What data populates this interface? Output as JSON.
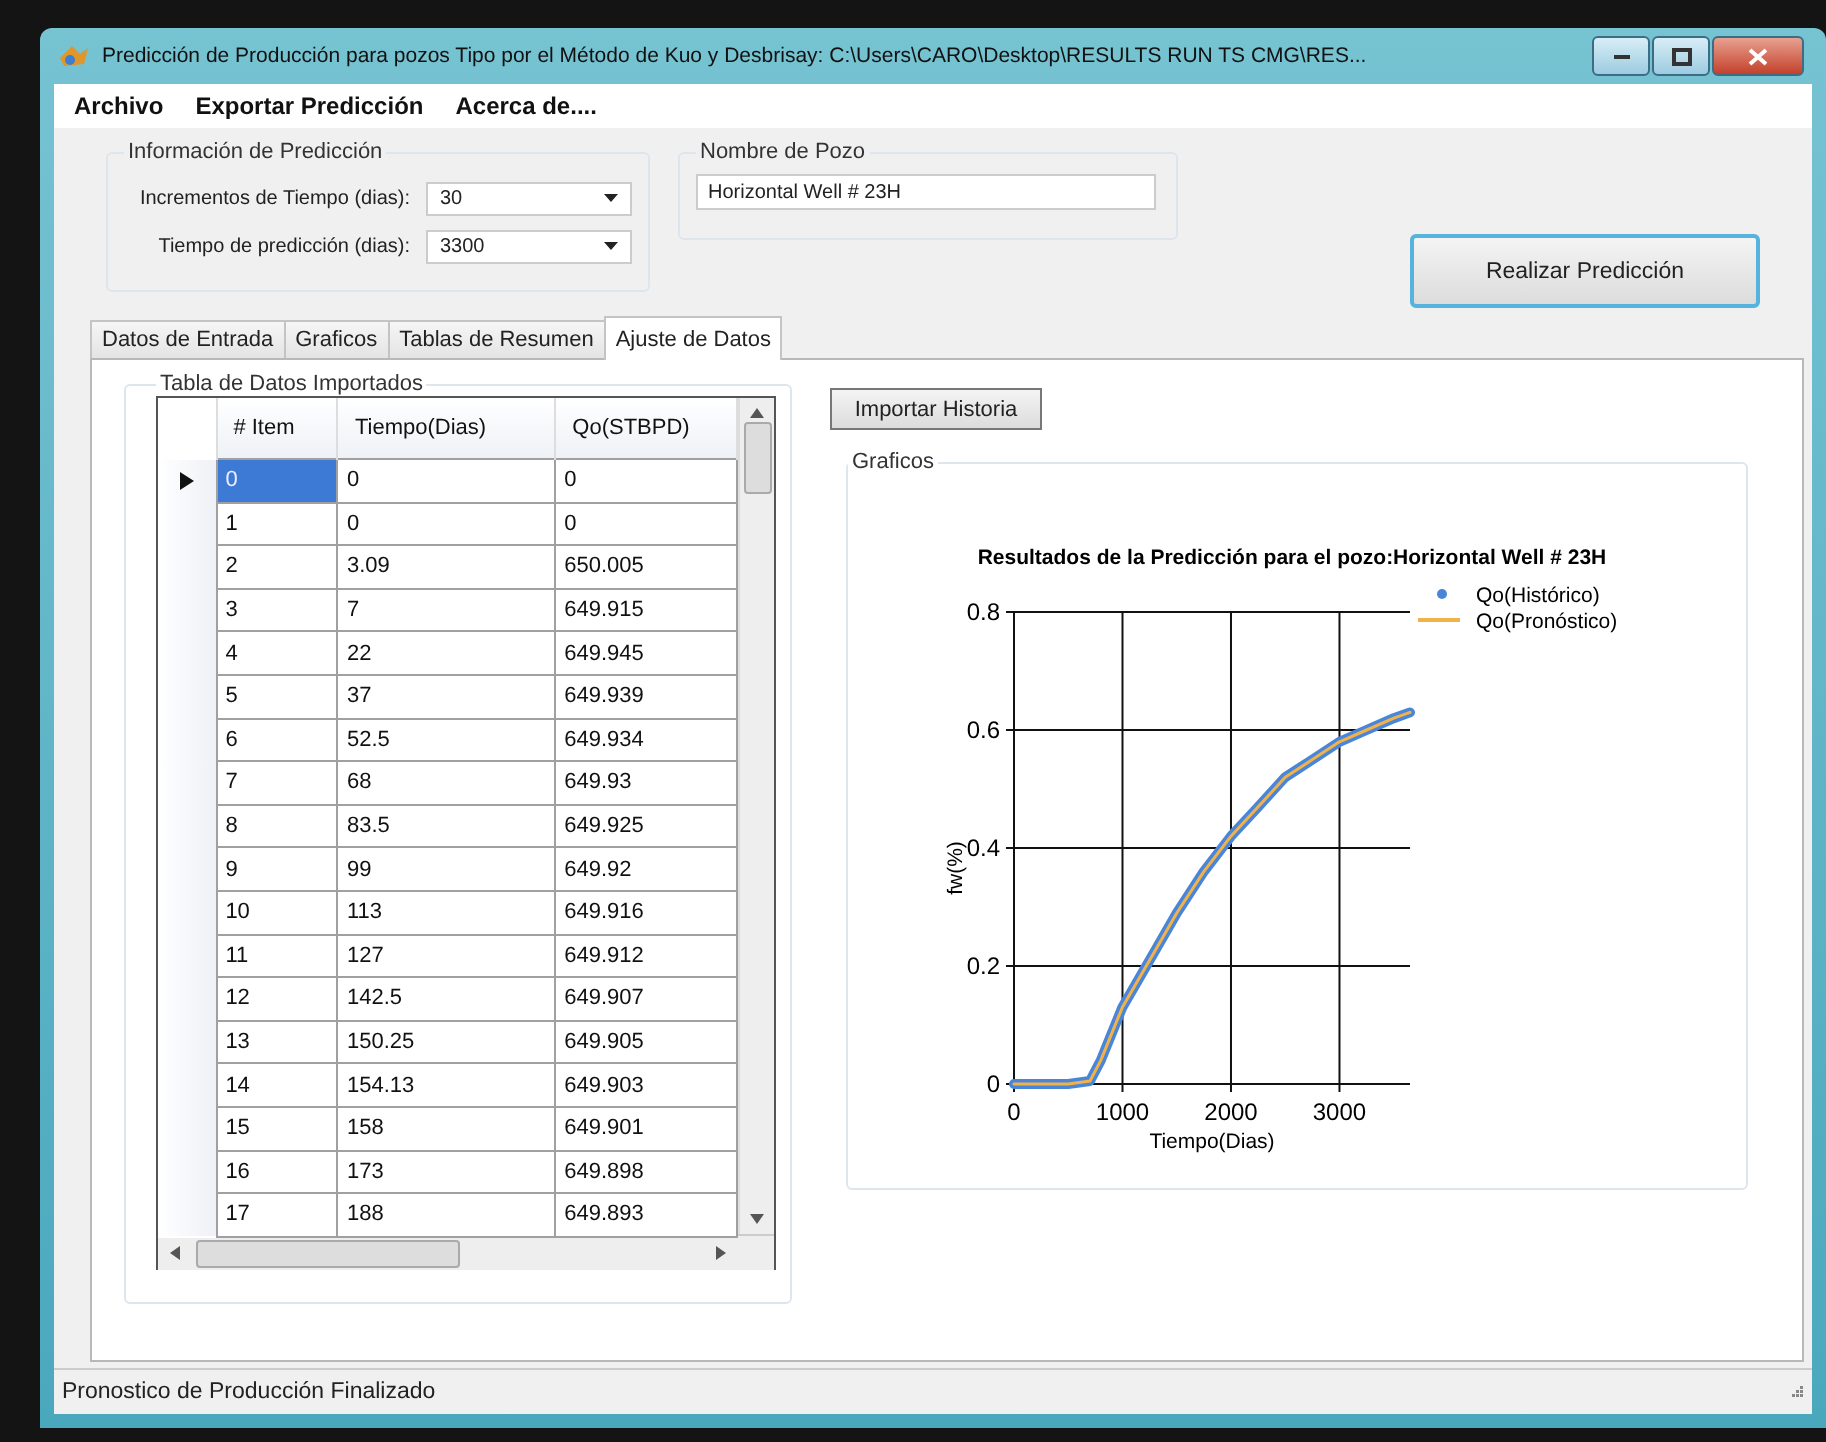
{
  "window": {
    "title": "Predicción de Producción para pozos Tipo por el Método de Kuo y Desbrisay: C:\\Users\\CARO\\Desktop\\RESULTS RUN TS CMG\\RES..."
  },
  "menu": [
    "Archivo",
    "Exportar Predicción",
    "Acerca de...."
  ],
  "prediction_info": {
    "title": "Información de Predicción",
    "fields": [
      {
        "label": "Incrementos de Tiempo (dias):",
        "value": "30"
      },
      {
        "label": "Tiempo de predicción (dias):",
        "value": "3300"
      }
    ]
  },
  "well_name": {
    "title": "Nombre de Pozo",
    "value": "Horizontal Well # 23H"
  },
  "predict_button": "Realizar Predicción",
  "tabs": [
    {
      "label": "Datos de Entrada",
      "selected": false
    },
    {
      "label": "Graficos",
      "selected": false
    },
    {
      "label": "Tablas de Resumen",
      "selected": false
    },
    {
      "label": "Ajuste de Datos",
      "selected": true
    }
  ],
  "imported_table": {
    "title": "Tabla de Datos Importados",
    "columns": [
      "# Item",
      "Tiempo(Dias)",
      "Qo(STBPD)"
    ],
    "rows": [
      {
        "cells": [
          "0",
          "0",
          "0"
        ],
        "selected": true
      },
      {
        "cells": [
          "1",
          "0",
          "0"
        ],
        "selected": false
      },
      {
        "cells": [
          "2",
          "3.09",
          "650.005"
        ],
        "selected": false
      },
      {
        "cells": [
          "3",
          "7",
          "649.915"
        ],
        "selected": false
      },
      {
        "cells": [
          "4",
          "22",
          "649.945"
        ],
        "selected": false
      },
      {
        "cells": [
          "5",
          "37",
          "649.939"
        ],
        "selected": false
      },
      {
        "cells": [
          "6",
          "52.5",
          "649.934"
        ],
        "selected": false
      },
      {
        "cells": [
          "7",
          "68",
          "649.93"
        ],
        "selected": false
      },
      {
        "cells": [
          "8",
          "83.5",
          "649.925"
        ],
        "selected": false
      },
      {
        "cells": [
          "9",
          "99",
          "649.92"
        ],
        "selected": false
      },
      {
        "cells": [
          "10",
          "113",
          "649.916"
        ],
        "selected": false
      },
      {
        "cells": [
          "11",
          "127",
          "649.912"
        ],
        "selected": false
      },
      {
        "cells": [
          "12",
          "142.5",
          "649.907"
        ],
        "selected": false
      },
      {
        "cells": [
          "13",
          "150.25",
          "649.905"
        ],
        "selected": false
      },
      {
        "cells": [
          "14",
          "154.13",
          "649.903"
        ],
        "selected": false
      },
      {
        "cells": [
          "15",
          "158",
          "649.901"
        ],
        "selected": false
      },
      {
        "cells": [
          "16",
          "173",
          "649.898"
        ],
        "selected": false
      },
      {
        "cells": [
          "17",
          "188",
          "649.893"
        ],
        "selected": false
      }
    ]
  },
  "import_button": "Importar Historia",
  "charts_group": {
    "title": "Graficos",
    "chart_data": {
      "type": "line",
      "title": "Resultados de la Predicción para el pozo:Horizontal Well # 23H",
      "xlabel": "Tiempo(Dias)",
      "ylabel": "fw(%)",
      "x": [
        0,
        250,
        500,
        700,
        800,
        1000,
        1250,
        1500,
        1750,
        2000,
        2250,
        2500,
        2750,
        3000,
        3250,
        3500,
        3650
      ],
      "series": [
        {
          "name": "Qo(Histórico)",
          "color": "#4a86d8",
          "values": [
            0,
            0,
            0,
            0.005,
            0.04,
            0.13,
            0.21,
            0.29,
            0.36,
            0.42,
            0.47,
            0.52,
            0.55,
            0.58,
            0.6,
            0.62,
            0.63
          ]
        },
        {
          "name": "Qo(Pronóstico)",
          "color": "#f2b24a",
          "values": [
            0,
            0,
            0,
            0.005,
            0.04,
            0.13,
            0.21,
            0.29,
            0.36,
            0.42,
            0.47,
            0.52,
            0.55,
            0.58,
            0.6,
            0.62,
            0.63
          ]
        }
      ],
      "grid": true,
      "legend": true,
      "xlim": [
        0,
        3650
      ],
      "ylim": [
        0,
        0.8
      ],
      "xticks": [
        0,
        1000,
        2000,
        3000
      ],
      "yticks": [
        0,
        0.2,
        0.4,
        0.6,
        0.8
      ]
    }
  },
  "status_bar": "Pronostico de Producción Finalizado"
}
